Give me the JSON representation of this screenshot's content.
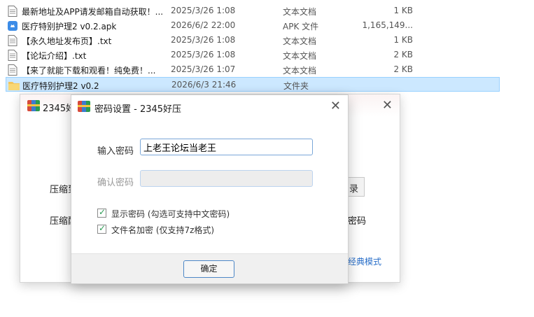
{
  "files": [
    {
      "name": "最新地址及APP请发邮箱自动获取！...",
      "date": "2025/3/26 1:08",
      "type": "文本文档",
      "size": "1 KB",
      "icon": "text-file-icon"
    },
    {
      "name": "医疗特别护理2 v0.2.apk",
      "date": "2026/6/2 22:00",
      "type": "APK 文件",
      "size": "1,165,149...",
      "icon": "apk-file-icon"
    },
    {
      "name": "【永久地址发布页】.txt",
      "date": "2025/3/26 1:08",
      "type": "文本文档",
      "size": "1 KB",
      "icon": "text-file-icon"
    },
    {
      "name": "【论坛介绍】.txt",
      "date": "2025/3/26 1:08",
      "type": "文本文档",
      "size": "2 KB",
      "icon": "text-file-icon"
    },
    {
      "name": "【来了就能下载和观看！纯免费！...",
      "date": "2025/3/26 1:07",
      "type": "文本文档",
      "size": "2 KB",
      "icon": "text-file-icon"
    },
    {
      "name": "医疗特别护理2 v0.2",
      "date": "2026/6/3 21:46",
      "type": "文件夹",
      "size": "",
      "icon": "folder-icon"
    }
  ],
  "back_window": {
    "title": "2345好",
    "label1": "压缩到",
    "label2": "压缩配",
    "browse": "录",
    "right_text": "密码",
    "classic_link": "经典模式"
  },
  "dialog": {
    "title": "密码设置 - 2345好压",
    "close": "✕",
    "password_label": "输入密码",
    "password_value": "上老王论坛当老王",
    "confirm_label": "确认密码",
    "confirm_value": "",
    "show_password": "显示密码 (勾选可支持中文密码)",
    "encrypt_names": "文件名加密 (仅支持7z格式)",
    "ok": "确定"
  },
  "colors": {
    "selection": "#cce8ff",
    "accent": "#4d87c7",
    "check": "#2a9a52"
  }
}
